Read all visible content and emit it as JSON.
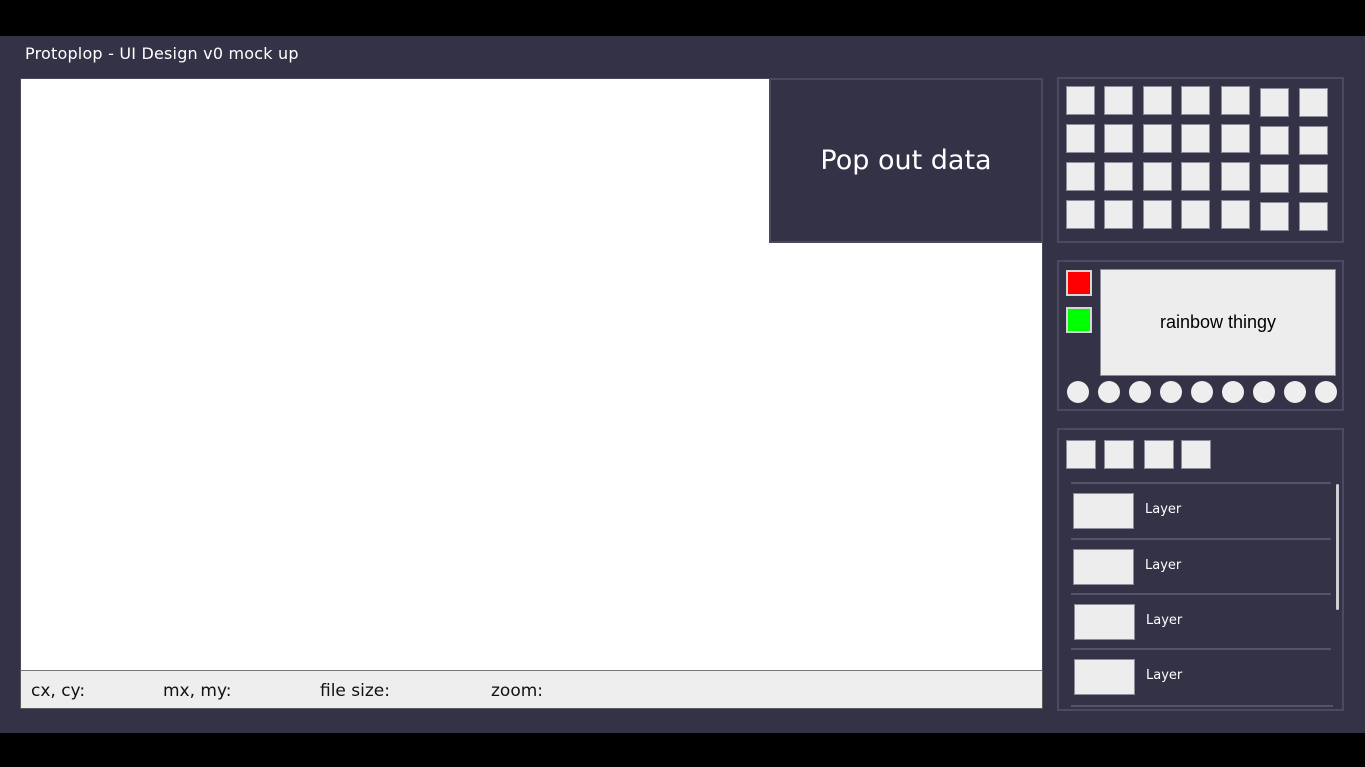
{
  "app": {
    "title": "Protoplop - UI Design v0 mock up"
  },
  "popout": {
    "label": "Pop out data"
  },
  "statusbar": {
    "cursor_label": "cx, cy:",
    "mouse_label": "mx, my:",
    "filesize_label": "file size:",
    "zoom_label": "zoom:"
  },
  "color_panel": {
    "primary_color": "#ff0000",
    "secondary_color": "#00ff00",
    "rainbow_label": "rainbow thingy"
  },
  "layers": {
    "items": [
      {
        "label": "Layer"
      },
      {
        "label": "Layer"
      },
      {
        "label": "Layer"
      },
      {
        "label": "Layer"
      }
    ]
  },
  "theme": {
    "background": "#343247",
    "canvas": "#ffffff",
    "accent_border": "#4c4a63"
  }
}
